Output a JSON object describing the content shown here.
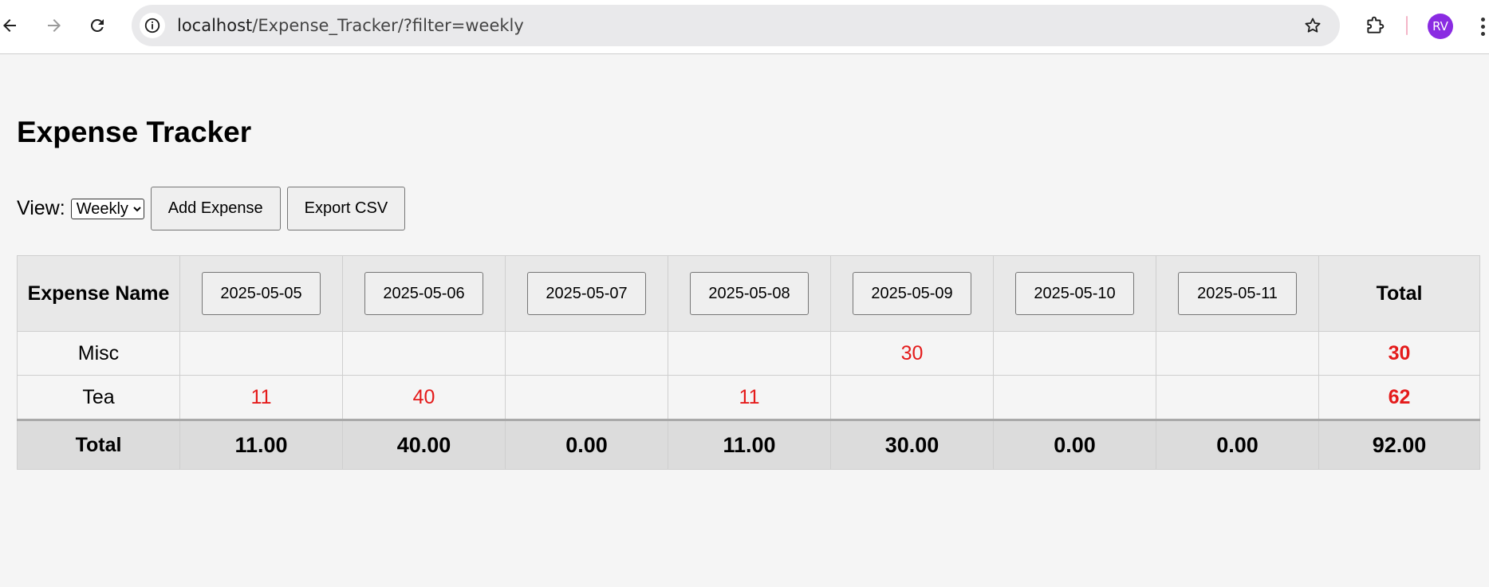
{
  "browser": {
    "url_host": "localhost",
    "url_path": "/Expense_Tracker/?filter=weekly",
    "avatar_initials": "RV",
    "avatar_color": "#8a2be2"
  },
  "page": {
    "title": "Expense Tracker",
    "view_label": "View:",
    "view_selected": "Weekly",
    "add_button": "Add Expense",
    "export_button": "Export CSV"
  },
  "table": {
    "name_header": "Expense Name",
    "total_header": "Total",
    "dates": [
      "2025-05-05",
      "2025-05-06",
      "2025-05-07",
      "2025-05-08",
      "2025-05-09",
      "2025-05-10",
      "2025-05-11"
    ],
    "rows": [
      {
        "name": "Misc",
        "values": [
          "",
          "",
          "",
          "",
          "30",
          "",
          ""
        ],
        "total": "30"
      },
      {
        "name": "Tea",
        "values": [
          "11",
          "40",
          "",
          "11",
          "",
          "",
          ""
        ],
        "total": "62"
      }
    ],
    "footer": {
      "label": "Total",
      "values": [
        "11.00",
        "40.00",
        "0.00",
        "11.00",
        "30.00",
        "0.00",
        "0.00"
      ],
      "grand_total": "92.00"
    }
  },
  "colors": {
    "value_red": "#e41b1b",
    "header_bg": "#e8e8e8",
    "footer_bg": "#dcdcdc"
  }
}
